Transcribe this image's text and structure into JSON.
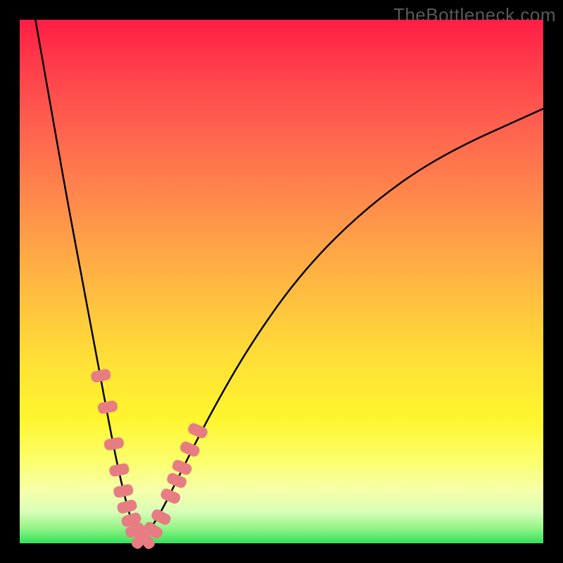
{
  "watermark": "TheBottleneck.com",
  "colors": {
    "frame": "#000000",
    "curve": "#000000",
    "marker": "#e77d82",
    "gradient_stops": [
      "#ff1d45",
      "#ff7d4d",
      "#ffe236",
      "#fcff6a",
      "#35e158"
    ]
  },
  "chart_data": {
    "type": "line",
    "title": "",
    "xlabel": "",
    "ylabel": "",
    "xlim": [
      0,
      100
    ],
    "ylim": [
      0,
      100
    ],
    "notes": "Filled V-shaped bottleneck curve on a thermal gradient background. X axis is component balance (approximate, no tick labels shown). Y axis is bottleneck % (approximate, no tick labels). Minimum (0% bottleneck) occurs near x≈23. Pink markers cluster along both arms of the curve near the minimum.",
    "series": [
      {
        "name": "left-arm",
        "x": [
          3,
          6,
          9,
          12,
          15,
          18,
          20,
          22,
          23
        ],
        "y": [
          100,
          83,
          66,
          50,
          34,
          18,
          9,
          2,
          0
        ]
      },
      {
        "name": "right-arm",
        "x": [
          23,
          26,
          30,
          36,
          44,
          54,
          66,
          80,
          100
        ],
        "y": [
          0,
          4,
          12,
          24,
          38,
          52,
          64,
          74,
          83
        ]
      }
    ],
    "markers": {
      "comment": "pink rounded capsules along the curve in the low-bottleneck region",
      "points": [
        {
          "x": 15.5,
          "y": 32
        },
        {
          "x": 16.8,
          "y": 26
        },
        {
          "x": 18.0,
          "y": 19
        },
        {
          "x": 19.0,
          "y": 14
        },
        {
          "x": 19.8,
          "y": 10
        },
        {
          "x": 20.5,
          "y": 7
        },
        {
          "x": 21.3,
          "y": 4.5
        },
        {
          "x": 22.0,
          "y": 2.5
        },
        {
          "x": 23.0,
          "y": 0.7
        },
        {
          "x": 24.2,
          "y": 0.7
        },
        {
          "x": 25.5,
          "y": 2.5
        },
        {
          "x": 27.0,
          "y": 5
        },
        {
          "x": 28.8,
          "y": 9
        },
        {
          "x": 30.0,
          "y": 12
        },
        {
          "x": 31.0,
          "y": 14.5
        },
        {
          "x": 32.5,
          "y": 18
        },
        {
          "x": 34.0,
          "y": 21.5
        }
      ]
    }
  }
}
